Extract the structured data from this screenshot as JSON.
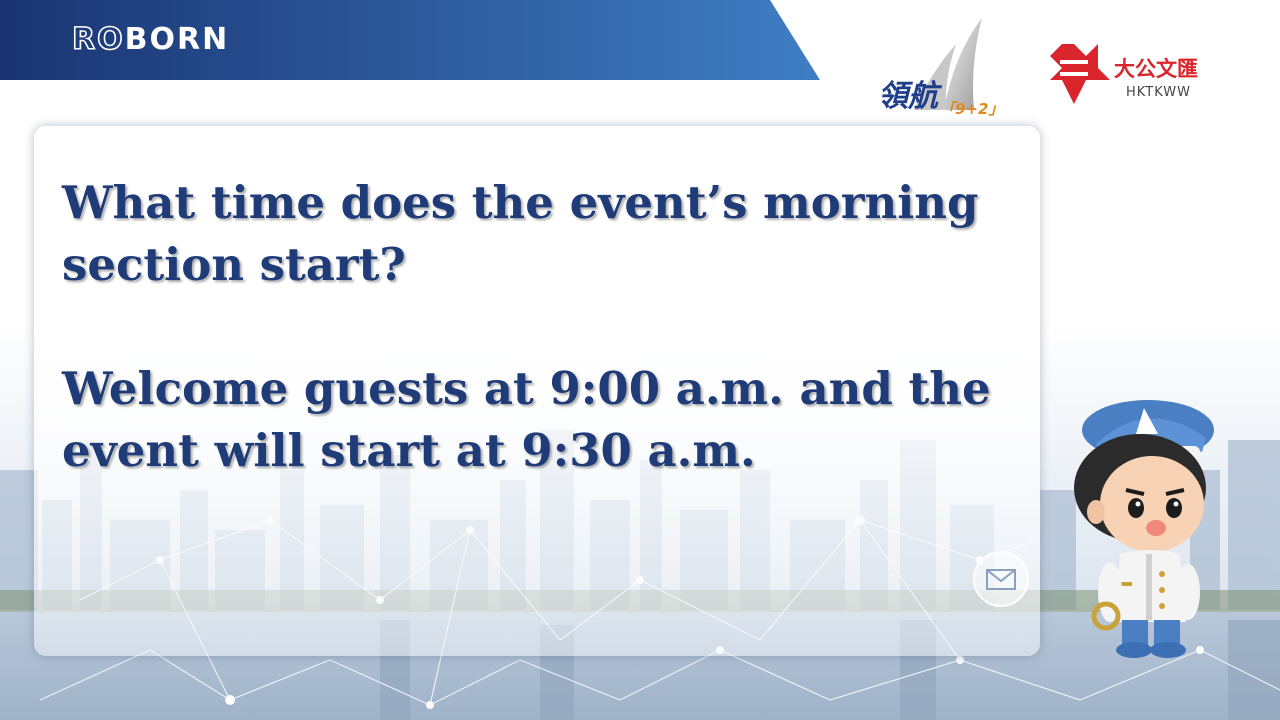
{
  "header": {
    "brand_outline": "RO",
    "brand_solid": "BORN",
    "logo_lh_text": "領航",
    "logo_lh_sub": "「9+2」",
    "logo_hk_cn": "大公文匯",
    "logo_hk_en": "HKTKWW"
  },
  "slide": {
    "question": "What time does the event’s morning section start?",
    "answer": "Welcome guests at 9:00 a.m. and the event will start at 9:30 a.m."
  },
  "colors": {
    "banner_dark": "#1a3472",
    "banner_light": "#3f7ec4",
    "text": "#1f3b78",
    "hk_red": "#d9252b"
  },
  "icons": [
    "mail-icon",
    "sailboat-logo",
    "star-emblem-logo",
    "mascot-character"
  ]
}
